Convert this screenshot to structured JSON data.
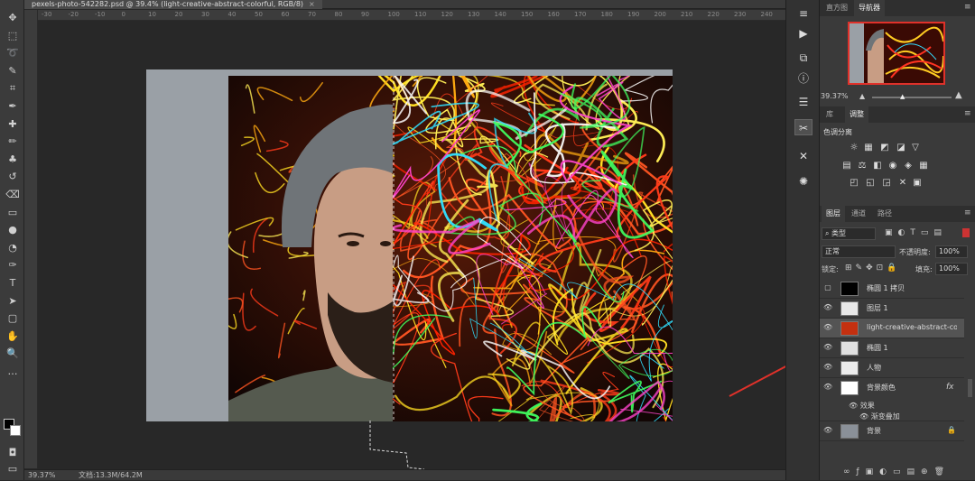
{
  "document": {
    "tab_title": "pexels-photo-542282.psd @ 39.4% (light-creative-abstract-colorful, RGB/8)",
    "close_glyph": "×",
    "zoom_status": "39.37%",
    "doc_info": "文档:13.3M/64.2M"
  },
  "ruler": {
    "top_ticks": [
      "-30",
      "-20",
      "-10",
      "0",
      "10",
      "20",
      "30",
      "40",
      "50",
      "60",
      "70",
      "80",
      "90",
      "100",
      "110",
      "120",
      "130",
      "140",
      "150",
      "160",
      "170",
      "180",
      "190",
      "200",
      "210",
      "220",
      "230",
      "240"
    ]
  },
  "toolbar": {
    "tools": [
      {
        "name": "move-tool-icon",
        "glyph": "✥"
      },
      {
        "name": "marquee-tool-icon",
        "glyph": "⬚"
      },
      {
        "name": "lasso-tool-icon",
        "glyph": "➰"
      },
      {
        "name": "quick-select-tool-icon",
        "glyph": "✎"
      },
      {
        "name": "crop-tool-icon",
        "glyph": "⌗"
      },
      {
        "name": "eyedropper-tool-icon",
        "glyph": "✒"
      },
      {
        "name": "healing-brush-icon",
        "glyph": "✚"
      },
      {
        "name": "brush-tool-icon",
        "glyph": "✏"
      },
      {
        "name": "clone-stamp-icon",
        "glyph": "♣"
      },
      {
        "name": "history-brush-icon",
        "glyph": "↺"
      },
      {
        "name": "eraser-tool-icon",
        "glyph": "⌫"
      },
      {
        "name": "gradient-tool-icon",
        "glyph": "▭"
      },
      {
        "name": "blur-tool-icon",
        "glyph": "●"
      },
      {
        "name": "dodge-tool-icon",
        "glyph": "◔"
      },
      {
        "name": "pen-tool-icon",
        "glyph": "✑"
      },
      {
        "name": "type-tool-icon",
        "glyph": "T"
      },
      {
        "name": "path-select-icon",
        "glyph": "➤"
      },
      {
        "name": "shape-tool-icon",
        "glyph": "▢"
      },
      {
        "name": "hand-tool-icon",
        "glyph": "✋"
      },
      {
        "name": "zoom-tool-icon",
        "glyph": "🔍"
      },
      {
        "name": "more-tools-icon",
        "glyph": "…"
      }
    ]
  },
  "navigator": {
    "tabs": [
      "直方图",
      "导航器"
    ],
    "zoom": "39.37%"
  },
  "adjustments": {
    "tabs": [
      "库",
      "调整"
    ],
    "heading": "色调分离"
  },
  "layers_panel": {
    "tabs": [
      "图层",
      "通道",
      "路径"
    ],
    "filter_kind": "类型",
    "blend_mode": "正常",
    "opacity_label": "不透明度:",
    "opacity_value": "100%",
    "lock_label": "锁定:",
    "fill_label": "填充:",
    "fill_value": "100%",
    "layers": [
      {
        "name": "椭圆 1 拷贝",
        "visible": false
      },
      {
        "name": "图层 1",
        "visible": true
      },
      {
        "name": "light-creative-abstract-col...",
        "visible": true,
        "selected": true
      },
      {
        "name": "椭圆 1",
        "visible": true
      },
      {
        "name": "人物",
        "visible": true
      },
      {
        "name": "背景颜色",
        "visible": true,
        "fx": "fx"
      },
      {
        "name": "背景",
        "visible": true
      }
    ],
    "effects_label": "效果",
    "effect_item": "渐变叠加"
  },
  "colors": {
    "accent_arrow": "#e0312a",
    "panel_bg": "#3a3a3a",
    "selected_layer": "#545454"
  }
}
